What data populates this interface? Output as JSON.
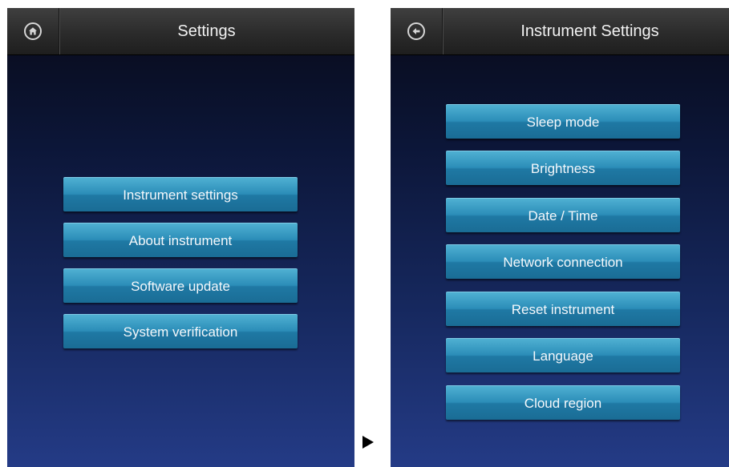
{
  "left_screen": {
    "title": "Settings",
    "nav_icon": "home-icon",
    "buttons": [
      "Instrument settings",
      "About instrument",
      "Software update",
      "System verification"
    ]
  },
  "right_screen": {
    "title": "Instrument Settings",
    "nav_icon": "back-arrow-icon",
    "buttons": [
      "Sleep mode",
      "Brightness",
      "Date / Time",
      "Network connection",
      "Reset instrument",
      "Language",
      "Cloud region"
    ]
  },
  "colors": {
    "button_accent": "#2b8db8",
    "topbar": "#2b2b2b",
    "background_top": "#080a18",
    "background_bottom": "#243b86"
  },
  "transition_icon": "right-triangle-arrow-icon"
}
